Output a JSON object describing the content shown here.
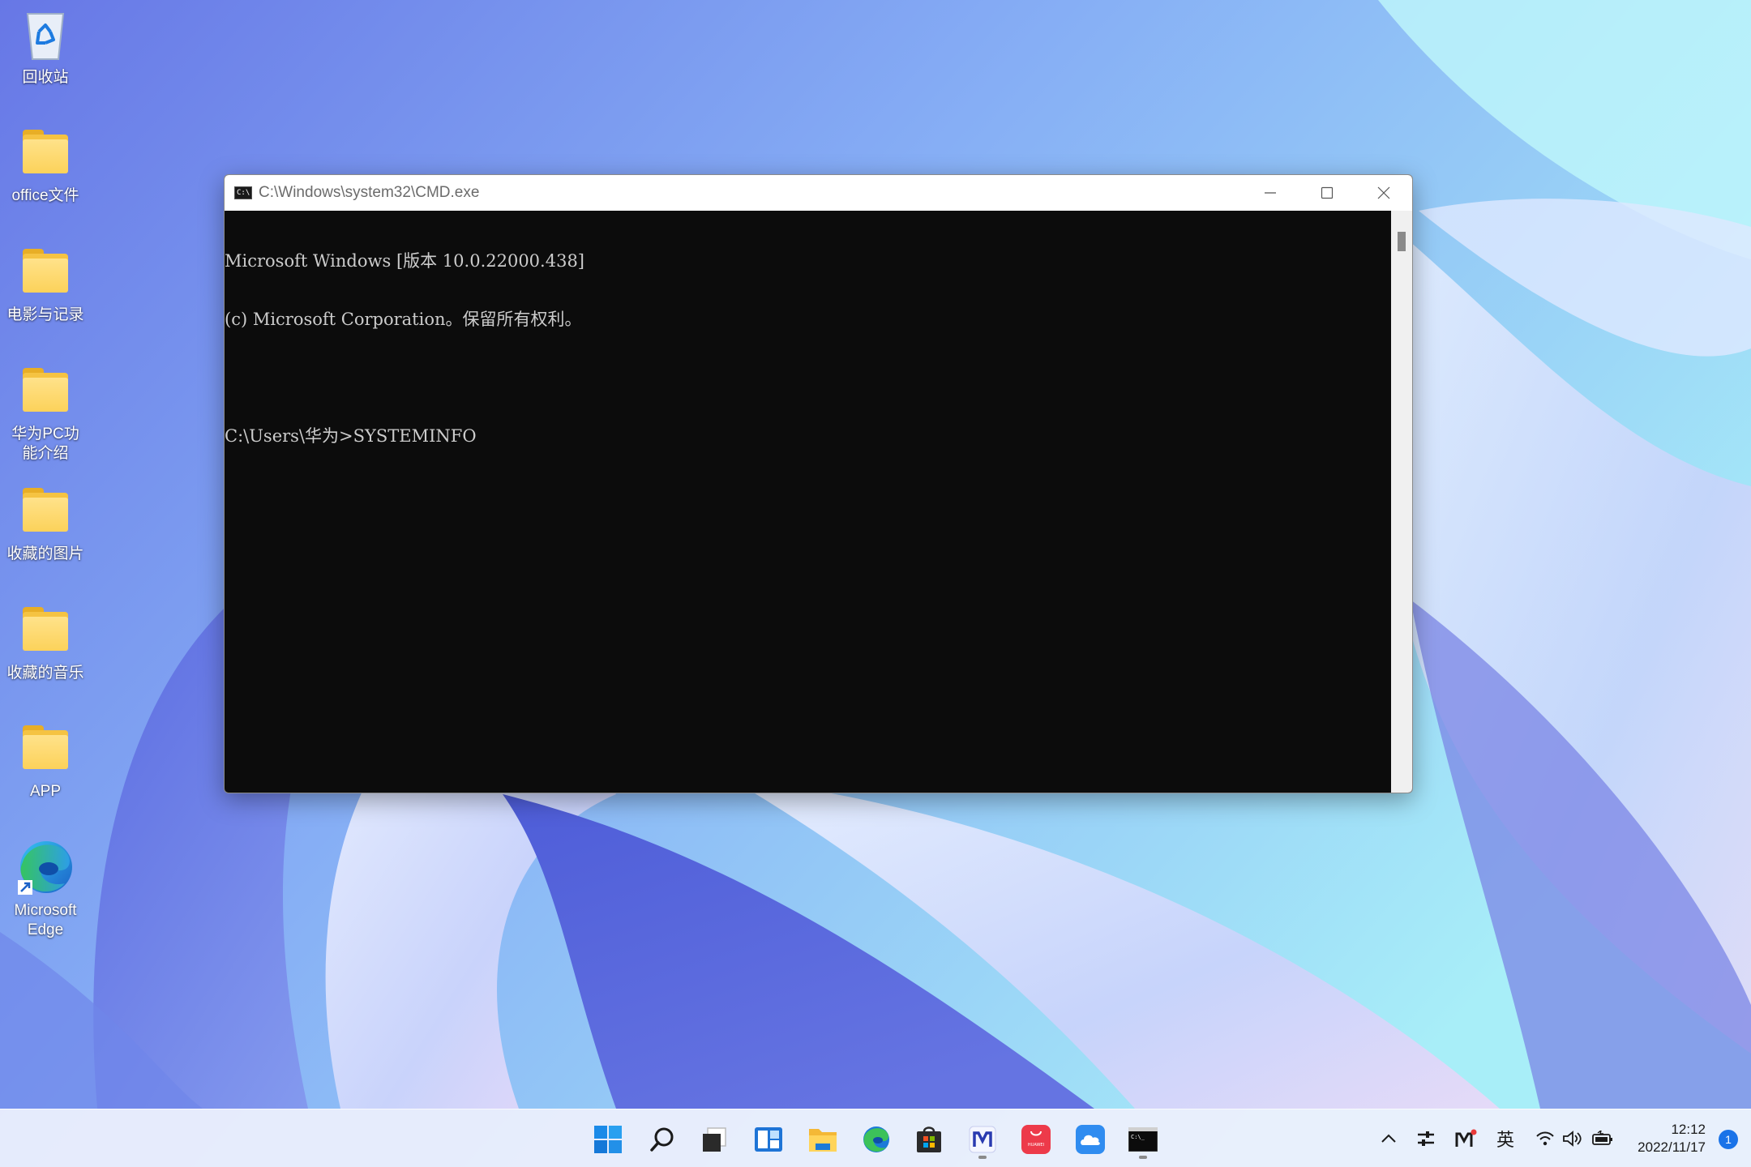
{
  "desktop": {
    "icons": [
      {
        "name": "recycle-bin",
        "label": "回收站",
        "icon": "recycle-bin-icon"
      },
      {
        "name": "folder",
        "label": "office文件",
        "icon": "folder-icon"
      },
      {
        "name": "folder",
        "label": "电影与记录",
        "icon": "folder-icon"
      },
      {
        "name": "folder",
        "label": "华为PC功能介绍",
        "icon": "folder-icon"
      },
      {
        "name": "folder",
        "label": "收藏的图片",
        "icon": "folder-icon"
      },
      {
        "name": "folder",
        "label": "收藏的音乐",
        "icon": "folder-icon"
      },
      {
        "name": "folder",
        "label": "APP",
        "icon": "folder-icon"
      },
      {
        "name": "edge-shortcut",
        "label": "Microsoft Edge",
        "icon": "edge-icon"
      }
    ]
  },
  "cmd_window": {
    "title": "C:\\Windows\\system32\\CMD.exe",
    "controls": [
      "minimize",
      "maximize",
      "close"
    ],
    "lines": [
      "Microsoft Windows [版本 10.0.22000.438]",
      "(c) Microsoft Corporation。保留所有权利。",
      "",
      "C:\\Users\\华为>SYSTEMINFO"
    ]
  },
  "taskbar": {
    "apps": [
      {
        "name": "start",
        "icon": "windows-start-icon",
        "running": false
      },
      {
        "name": "search",
        "icon": "search-icon",
        "running": false
      },
      {
        "name": "task-view",
        "icon": "task-view-icon",
        "running": false
      },
      {
        "name": "widgets",
        "icon": "widgets-icon",
        "running": false
      },
      {
        "name": "file-explorer",
        "icon": "file-explorer-icon",
        "running": false
      },
      {
        "name": "edge",
        "icon": "edge-icon",
        "running": false
      },
      {
        "name": "store",
        "icon": "microsoft-store-icon",
        "running": false
      },
      {
        "name": "pc-manager",
        "icon": "huawei-pc-manager-icon",
        "running": true
      },
      {
        "name": "app-gallery",
        "icon": "huawei-appgallery-icon",
        "running": false
      },
      {
        "name": "cloud",
        "icon": "cloud-icon",
        "running": false
      },
      {
        "name": "terminal",
        "icon": "cmd-icon",
        "running": true
      }
    ],
    "app_gallery_text": "HUAWEI",
    "tray": {
      "chevron": "chevron-up-icon",
      "ime_label": "英",
      "icons": [
        "settings-sliders-icon",
        "huawei-m-icon",
        "wifi-icon",
        "volume-icon",
        "battery-icon"
      ]
    },
    "clock": {
      "time": "12:12",
      "date": "2022/11/17"
    },
    "notification_count": "1"
  }
}
